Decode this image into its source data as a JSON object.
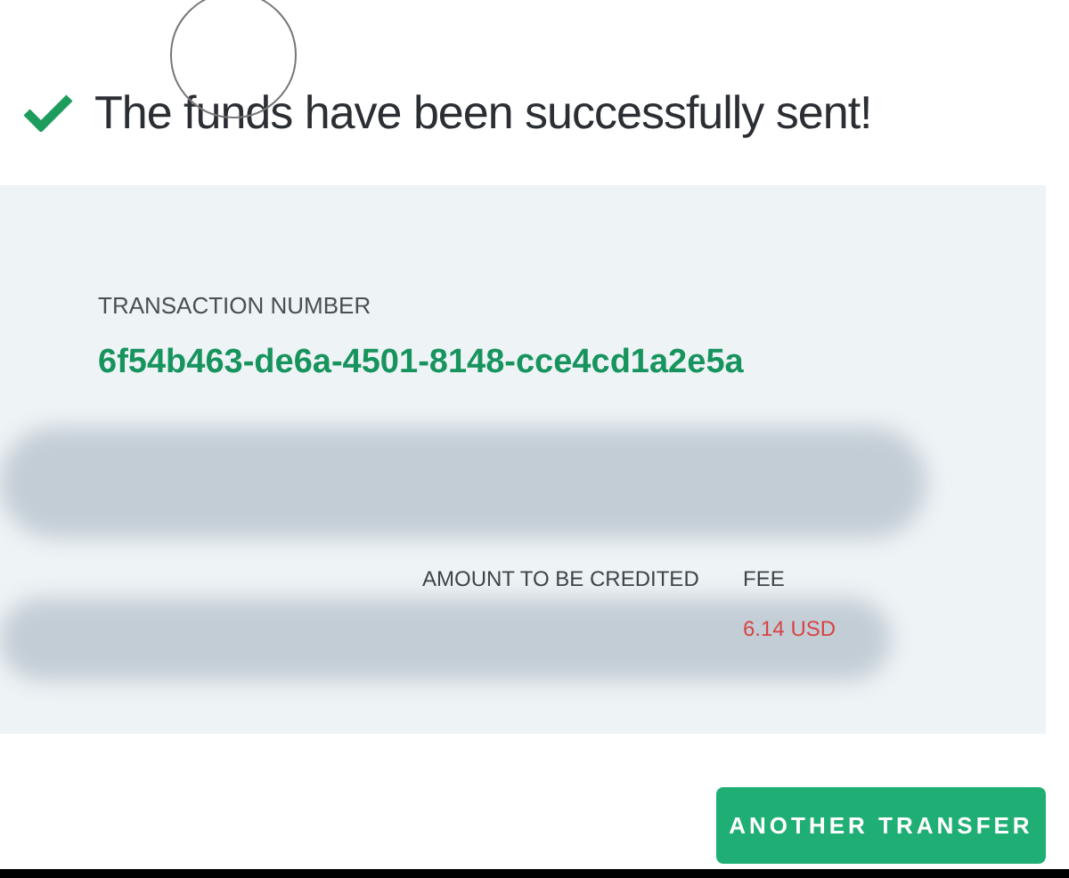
{
  "heading": "The funds have been successfully sent!",
  "transaction": {
    "label": "TRANSACTION NUMBER",
    "value": "6f54b463-de6a-4501-8148-cce4cd1a2e5a"
  },
  "details_rows": [
    {
      "kind": "redacted"
    },
    {
      "kind": "fields",
      "fields": [
        {
          "label": "AMOUNT TO BE CREDITED"
        },
        {
          "label": "FEE",
          "value": "6.14 USD"
        }
      ]
    }
  ],
  "button": "ANOTHER TRANSFER"
}
